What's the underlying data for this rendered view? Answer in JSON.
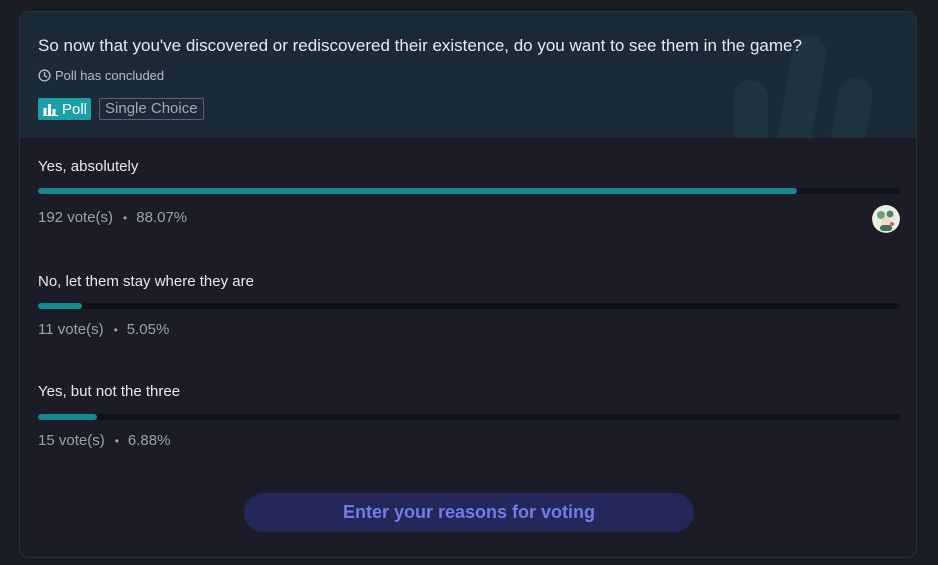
{
  "poll": {
    "question": "So now that you've discovered or rediscovered their existence, do you want to see them in the game?",
    "status": "Poll has concluded",
    "tag_poll": "Poll",
    "tag_type": "Single Choice",
    "accent_color": "#16898f",
    "options": [
      {
        "label": "Yes, absolutely",
        "votes": "192 vote(s)",
        "percent": "88.07%",
        "fraction": 0.8807
      },
      {
        "label": "No, let them stay where they are",
        "votes": "11 vote(s)",
        "percent": "5.05%",
        "fraction": 0.0505
      },
      {
        "label": "Yes, but not the three",
        "votes": "15 vote(s)",
        "percent": "6.88%",
        "fraction": 0.0688
      }
    ],
    "separator": "•",
    "reason_button": "Enter your reasons for voting"
  },
  "icons": {
    "status": "clock-icon",
    "poll_tag": "bar-chart-icon",
    "voter": "avatar"
  }
}
